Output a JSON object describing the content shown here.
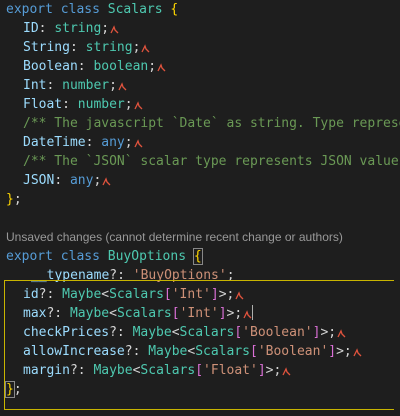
{
  "editor": {
    "scalars_block": {
      "export_kw": "export",
      "class_kw": "class",
      "class_name": "Scalars",
      "open_brace": "{",
      "close_brace": "}",
      "semicolon": ";",
      "fields": [
        {
          "name": "ID",
          "type": "string"
        },
        {
          "name": "String",
          "type": "string"
        },
        {
          "name": "Boolean",
          "type": "boolean"
        },
        {
          "name": "Int",
          "type": "number"
        },
        {
          "name": "Float",
          "type": "number"
        }
      ],
      "comment_date": "/** The javascript `Date` as string. Type represe",
      "datetime_name": "DateTime",
      "datetime_type": "any",
      "comment_json": "/** The `JSON` scalar type represents JSON values",
      "json_name": "JSON",
      "json_type": "any"
    },
    "codelens_text": "Unsaved changes (cannot determine recent change or authors)",
    "buy_options_block": {
      "export_kw": "export",
      "class_kw": "class",
      "class_name": "BuyOptions",
      "open_brace": "{",
      "close_brace": "}",
      "semicolon": ";",
      "typename_prop": "__typename",
      "typename_value": "'BuyOptions'",
      "fields": [
        {
          "name": "id",
          "wrapper": "Maybe",
          "scalar": "Scalars",
          "key": "'Int'"
        },
        {
          "name": "max",
          "wrapper": "Maybe",
          "scalar": "Scalars",
          "key": "'Int'"
        },
        {
          "name": "checkPrices",
          "wrapper": "Maybe",
          "scalar": "Scalars",
          "key": "'Boolean'"
        },
        {
          "name": "allowIncrease",
          "wrapper": "Maybe",
          "scalar": "Scalars",
          "key": "'Boolean'"
        },
        {
          "name": "margin",
          "wrapper": "Maybe",
          "scalar": "Scalars",
          "key": "'Float'"
        }
      ]
    }
  },
  "colors": {
    "background": "#1e1e1e",
    "keyword": "#569cd6",
    "type": "#4ec9b0",
    "property": "#9cdcfe",
    "comment": "#6a9955",
    "string": "#ce9178",
    "bracket_gold": "#ffd700",
    "bracket_violet": "#da70d6",
    "codelens": "#999999",
    "blame_marker": "#e0533d"
  }
}
